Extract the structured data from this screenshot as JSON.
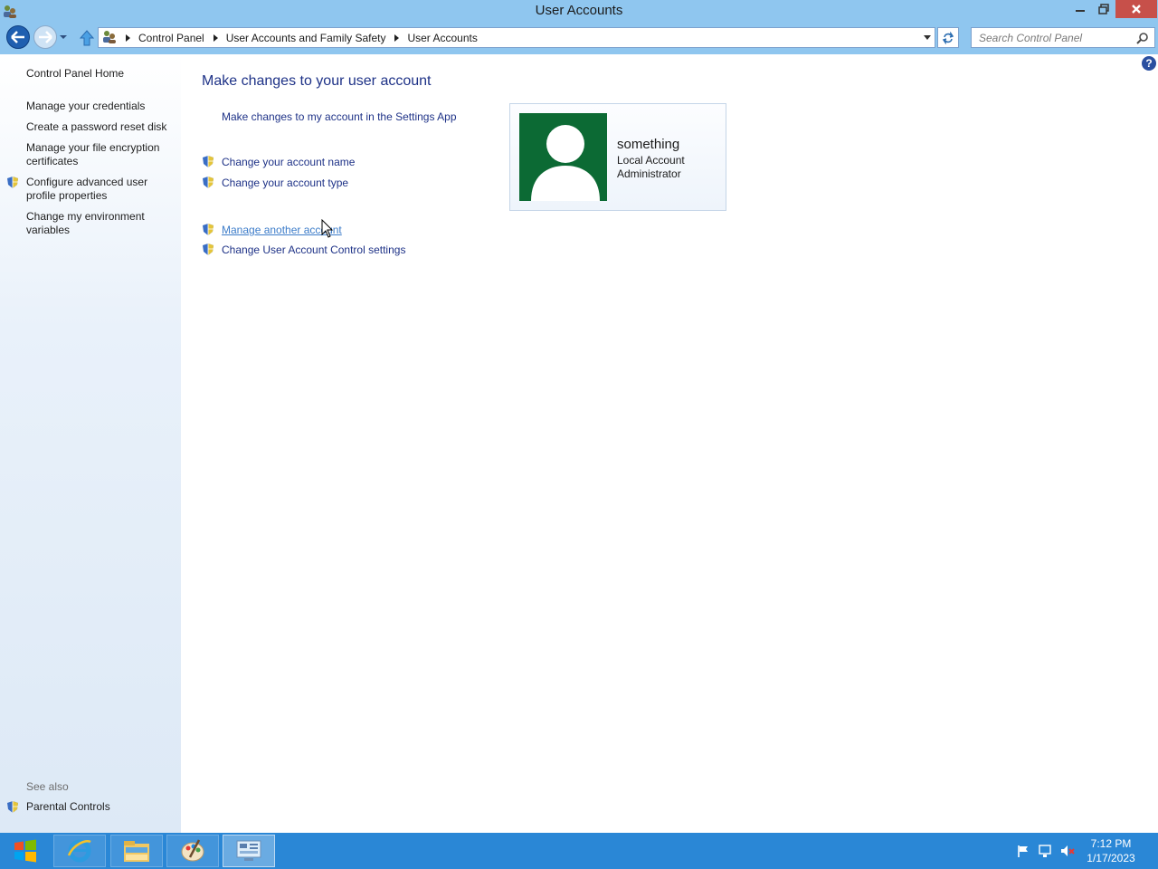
{
  "window": {
    "title": "User Accounts"
  },
  "address": {
    "breadcrumbs": [
      "Control Panel",
      "User Accounts and Family Safety",
      "User Accounts"
    ],
    "search_placeholder": "Search Control Panel"
  },
  "sidebar": {
    "home": "Control Panel Home",
    "links": [
      "Manage your credentials",
      "Create a password reset disk",
      "Manage your file encryption certificates",
      "Configure advanced user profile properties",
      "Change my environment variables"
    ],
    "see_also_label": "See also",
    "see_also_links": [
      "Parental Controls"
    ]
  },
  "main": {
    "title": "Make changes to your user account",
    "tasks": [
      "Make changes to my account in the Settings App",
      "Change your account name",
      "Change your account type",
      "Manage another account",
      "Change User Account Control settings"
    ],
    "account": {
      "name": "something",
      "type": "Local Account",
      "role": "Administrator"
    }
  },
  "taskbar": {
    "apps": [
      "internet-explorer-icon",
      "file-explorer-icon",
      "paint-icon",
      "control-panel-icon"
    ],
    "time": "7:12 PM",
    "date": "1/17/2023"
  },
  "colors": {
    "titlebar": "#8fc6ef",
    "link": "#1e3287",
    "taskbar": "#2a87d6",
    "avatar_bg": "#0c6a34"
  }
}
